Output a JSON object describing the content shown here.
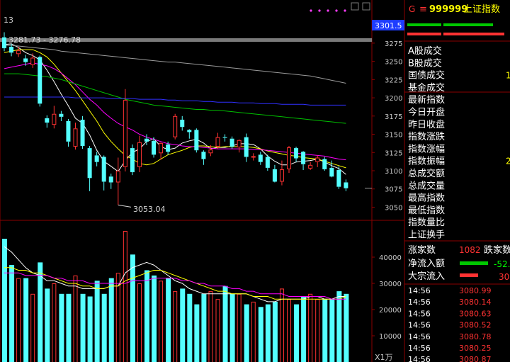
{
  "header": {
    "code": "999999",
    "name": "上证指数",
    "corner_num": "13",
    "current_tag": "3301.5",
    "unit_tag": "X1万",
    "g_label": "G",
    "menu_glyph": "≡"
  },
  "annotations": {
    "range_label": "3281.73 - 3276.78",
    "low_label": "3053.04"
  },
  "side": {
    "stats_labels": [
      "A股成交",
      "B股成交",
      "国债成交",
      "基金成交",
      "最新指数",
      "今日开盘",
      "昨日收盘",
      "指数涨跌",
      "指数涨幅",
      "指数振幅",
      "总成交额",
      "总成交量",
      "最高指数",
      "最低指数",
      "指数量比",
      "上证换手"
    ],
    "stats_partial": [
      {
        "index": 2,
        "text": "1"
      },
      {
        "index": 9,
        "text": "2"
      }
    ],
    "up_down_label": "涨家数",
    "up_count": "1082",
    "down_label": "跌家数",
    "net_inflow_label": "净流入额",
    "net_inflow_value": "-52.",
    "block_label": "大宗流入",
    "block_value": "30.",
    "ticks": [
      {
        "time": "14:56",
        "price": "3080.99"
      },
      {
        "time": "14:56",
        "price": "3080.14"
      },
      {
        "time": "14:56",
        "price": "3080.63"
      },
      {
        "time": "14:56",
        "price": "3080.52"
      },
      {
        "time": "14:56",
        "price": "3080.78"
      },
      {
        "time": "14:56",
        "price": "3080.25"
      },
      {
        "time": "14:56",
        "price": "3080.87"
      }
    ]
  },
  "colors": {
    "up": "#ff3232",
    "down": "#54ffff",
    "grid": "#8b0000",
    "axis_text": "#c8c8c8",
    "ma5": "#ffffff",
    "ma10": "#ffff00",
    "ma20": "#ff00ff",
    "ma30": "#00c000",
    "ma60": "#9a9a9a",
    "ma_blue": "#3030ff",
    "price_tick": "#ff3232",
    "side_label": "#ffffff"
  },
  "chart_data": [
    {
      "type": "candlestick",
      "ylim": [
        3032,
        3305
      ],
      "yticks": [
        3050,
        3075,
        3100,
        3125,
        3150,
        3175,
        3200,
        3225,
        3250,
        3275,
        3300
      ],
      "candles": [
        {
          "o": 3283,
          "c": 3268,
          "h": 3290,
          "l": 3264
        },
        {
          "o": 3270,
          "c": 3262,
          "h": 3274,
          "l": 3257
        },
        {
          "o": 3260,
          "c": 3265,
          "h": 3270,
          "l": 3256
        },
        {
          "o": 3254,
          "c": 3249,
          "h": 3259,
          "l": 3244
        },
        {
          "o": 3245,
          "c": 3255,
          "h": 3261,
          "l": 3241
        },
        {
          "o": 3256,
          "c": 3192,
          "h": 3258,
          "l": 3188
        },
        {
          "o": 3172,
          "c": 3166,
          "h": 3176,
          "l": 3159
        },
        {
          "o": 3163,
          "c": 3178,
          "h": 3189,
          "l": 3158
        },
        {
          "o": 3178,
          "c": 3174,
          "h": 3182,
          "l": 3168
        },
        {
          "o": 3168,
          "c": 3140,
          "h": 3171,
          "l": 3133
        },
        {
          "o": 3133,
          "c": 3158,
          "h": 3166,
          "l": 3129
        },
        {
          "o": 3170,
          "c": 3134,
          "h": 3175,
          "l": 3130
        },
        {
          "o": 3131,
          "c": 3090,
          "h": 3134,
          "l": 3072
        },
        {
          "o": 3121,
          "c": 3112,
          "h": 3126,
          "l": 3106
        },
        {
          "o": 3119,
          "c": 3085,
          "h": 3121,
          "l": 3073
        },
        {
          "o": 3092,
          "c": 3084,
          "h": 3096,
          "l": 3075
        },
        {
          "o": 3084,
          "c": 3100,
          "h": 3118,
          "l": 3053
        },
        {
          "o": 3105,
          "c": 3197,
          "h": 3212,
          "l": 3099
        },
        {
          "o": 3131,
          "c": 3098,
          "h": 3136,
          "l": 3094
        },
        {
          "o": 3105,
          "c": 3139,
          "h": 3148,
          "l": 3098
        },
        {
          "o": 3144,
          "c": 3140,
          "h": 3150,
          "l": 3135
        },
        {
          "o": 3141,
          "c": 3122,
          "h": 3146,
          "l": 3118
        },
        {
          "o": 3124,
          "c": 3138,
          "h": 3139,
          "l": 3115
        },
        {
          "o": 3136,
          "c": 3126,
          "h": 3140,
          "l": 3122
        },
        {
          "o": 3146,
          "c": 3175,
          "h": 3178,
          "l": 3143
        },
        {
          "o": 3170,
          "c": 3160,
          "h": 3175,
          "l": 3155
        },
        {
          "o": 3156,
          "c": 3153,
          "h": 3157,
          "l": 3144
        },
        {
          "o": 3156,
          "c": 3128,
          "h": 3158,
          "l": 3125
        },
        {
          "o": 3126,
          "c": 3116,
          "h": 3128,
          "l": 3108
        },
        {
          "o": 3124,
          "c": 3129,
          "h": 3135,
          "l": 3120
        },
        {
          "o": 3133,
          "c": 3146,
          "h": 3152,
          "l": 3130
        },
        {
          "o": 3146,
          "c": 3145,
          "h": 3150,
          "l": 3140
        },
        {
          "o": 3144,
          "c": 3133,
          "h": 3147,
          "l": 3130
        },
        {
          "o": 3132,
          "c": 3142,
          "h": 3143,
          "l": 3125
        },
        {
          "o": 3146,
          "c": 3119,
          "h": 3151,
          "l": 3112
        },
        {
          "o": 3118,
          "c": 3120,
          "h": 3124,
          "l": 3114
        },
        {
          "o": 3122,
          "c": 3112,
          "h": 3126,
          "l": 3108
        },
        {
          "o": 3119,
          "c": 3104,
          "h": 3122,
          "l": 3100
        },
        {
          "o": 3102,
          "c": 3085,
          "h": 3108,
          "l": 3084
        },
        {
          "o": 3085,
          "c": 3102,
          "h": 3114,
          "l": 3080
        },
        {
          "o": 3102,
          "c": 3132,
          "h": 3134,
          "l": 3097
        },
        {
          "o": 3131,
          "c": 3117,
          "h": 3133,
          "l": 3112
        },
        {
          "o": 3126,
          "c": 3109,
          "h": 3127,
          "l": 3101
        },
        {
          "o": 3103,
          "c": 3108,
          "h": 3112,
          "l": 3101
        },
        {
          "o": 3112,
          "c": 3118,
          "h": 3121,
          "l": 3105
        },
        {
          "o": 3116,
          "c": 3102,
          "h": 3119,
          "l": 3100
        },
        {
          "o": 3104,
          "c": 3092,
          "h": 3114,
          "l": 3091
        },
        {
          "o": 3101,
          "c": 3078,
          "h": 3106,
          "l": 3075
        },
        {
          "o": 3084,
          "c": 3076,
          "h": 3088,
          "l": 3072
        }
      ],
      "moving_averages": [
        {
          "key": "ma5",
          "values": [
            3273,
            3274,
            3269,
            3262,
            3258,
            3252,
            3238,
            3222,
            3205,
            3189,
            3172,
            3165,
            3149,
            3128,
            3113,
            3106,
            3099,
            3114,
            3125,
            3130,
            3140,
            3144,
            3133,
            3129,
            3131,
            3138,
            3141,
            3143,
            3138,
            3130,
            3132,
            3132,
            3134,
            3137,
            3137,
            3136,
            3130,
            3120,
            3113,
            3108,
            3108,
            3112,
            3113,
            3114,
            3116,
            3112,
            3107,
            3103,
            3095
          ]
        },
        {
          "key": "ma10",
          "values": [
            3262,
            3264,
            3266,
            3266,
            3266,
            3262,
            3256,
            3246,
            3234,
            3222,
            3210,
            3196,
            3182,
            3168,
            3152,
            3140,
            3130,
            3121,
            3116,
            3110,
            3108,
            3110,
            3116,
            3122,
            3125,
            3128,
            3132,
            3134,
            3134,
            3133,
            3132,
            3133,
            3133,
            3133,
            3133,
            3132,
            3130,
            3127,
            3125,
            3123,
            3121,
            3120,
            3118,
            3117,
            3116,
            3113,
            3110,
            3107,
            3104
          ]
        },
        {
          "key": "ma20",
          "values": [
            3240,
            3242,
            3244,
            3246,
            3248,
            3246,
            3244,
            3240,
            3234,
            3226,
            3218,
            3208,
            3198,
            3190,
            3180,
            3172,
            3165,
            3160,
            3156,
            3150,
            3146,
            3143,
            3140,
            3137,
            3136,
            3134,
            3133,
            3133,
            3132,
            3131,
            3130,
            3130,
            3130,
            3130,
            3130,
            3129,
            3129,
            3128,
            3127,
            3126,
            3125,
            3124,
            3123,
            3122,
            3121,
            3120,
            3118,
            3116,
            3115
          ]
        },
        {
          "key": "ma30",
          "values": [
            3233,
            3233,
            3233,
            3232,
            3231,
            3230,
            3229,
            3227,
            3225,
            3222,
            3219,
            3216,
            3213,
            3210,
            3207,
            3204,
            3201,
            3198,
            3196,
            3194,
            3192,
            3190,
            3189,
            3188,
            3187,
            3186,
            3185,
            3184,
            3184,
            3183,
            3183,
            3182,
            3181,
            3180,
            3179,
            3178,
            3177,
            3176,
            3175,
            3174,
            3173,
            3172,
            3171,
            3170,
            3169,
            3168,
            3167,
            3166,
            3165
          ]
        },
        {
          "key": "ma60",
          "values": [
            3272,
            3272,
            3271,
            3270,
            3269,
            3268,
            3267,
            3266,
            3264,
            3263,
            3262,
            3261,
            3260,
            3259,
            3258,
            3257,
            3256,
            3255,
            3254,
            3253,
            3252,
            3251,
            3250,
            3249,
            3249,
            3248,
            3247,
            3246,
            3245,
            3244,
            3243,
            3242,
            3241,
            3240,
            3239,
            3238,
            3237,
            3236,
            3235,
            3234,
            3233,
            3232,
            3231,
            3230,
            3228,
            3226,
            3224,
            3222,
            3220
          ]
        },
        {
          "key": "ma_blue",
          "values": [
            3201,
            3201,
            3201,
            3201,
            3201,
            3201,
            3201,
            3201,
            3201,
            3201,
            3200,
            3200,
            3200,
            3200,
            3200,
            3199,
            3199,
            3199,
            3199,
            3198,
            3198,
            3198,
            3198,
            3197,
            3197,
            3196,
            3196,
            3196,
            3195,
            3195,
            3194,
            3194,
            3194,
            3193,
            3193,
            3193,
            3192,
            3192,
            3192,
            3191,
            3191,
            3191,
            3191,
            3190,
            3190,
            3190,
            3190,
            3190,
            3190
          ]
        }
      ],
      "range_band": [
        3276.78,
        3281.73
      ]
    },
    {
      "type": "bar",
      "ylim": [
        0,
        50000
      ],
      "yticks": [
        10000,
        20000,
        30000,
        40000
      ],
      "volumes": [
        47000,
        37000,
        32000,
        32000,
        26000,
        38000,
        28000,
        30000,
        26000,
        26000,
        33000,
        26000,
        25000,
        31000,
        26000,
        32000,
        34000,
        50000,
        41000,
        30000,
        35000,
        33000,
        31000,
        32000,
        27000,
        28000,
        26000,
        22000,
        26000,
        27000,
        24000,
        29000,
        26000,
        26000,
        22000,
        23000,
        21000,
        22000,
        23000,
        28000,
        24000,
        22000,
        25000,
        26000,
        24000,
        24000,
        24000,
        27000,
        26000
      ],
      "vol_ma": [
        {
          "key": "ma5",
          "values": [
            44000,
            42000,
            39000,
            36000,
            34000,
            33000,
            31000,
            31000,
            30000,
            29000,
            29000,
            28000,
            28000,
            28000,
            28000,
            29000,
            29000,
            34000,
            36000,
            37000,
            38000,
            37000,
            35000,
            33000,
            31000,
            30000,
            28000,
            27000,
            26000,
            26000,
            26000,
            26000,
            26000,
            26000,
            26000,
            25000,
            24000,
            23000,
            23000,
            24000,
            24000,
            24000,
            24000,
            25000,
            25000,
            24000,
            24000,
            25000,
            25000
          ]
        },
        {
          "key": "ma10",
          "values": [
            36000,
            36000,
            35000,
            35000,
            34000,
            34000,
            33000,
            32000,
            31000,
            30000,
            30000,
            29000,
            29000,
            28000,
            28000,
            29000,
            29000,
            31000,
            32000,
            33000,
            34000,
            35000,
            35000,
            34000,
            33000,
            32000,
            31000,
            30000,
            29000,
            28000,
            27000,
            27000,
            26000,
            26000,
            26000,
            25000,
            25000,
            25000,
            24000,
            24000,
            24000,
            24000,
            24000,
            24000,
            24000,
            24000,
            24000,
            24000,
            25000
          ]
        },
        {
          "key": "ma20",
          "values": [
            34000,
            34000,
            34000,
            33000,
            33000,
            33000,
            33000,
            32000,
            32000,
            31000,
            31000,
            31000,
            30000,
            30000,
            30000,
            30000,
            30000,
            30000,
            31000,
            31000,
            31000,
            32000,
            32000,
            32000,
            32000,
            31000,
            31000,
            30000,
            30000,
            29000,
            29000,
            29000,
            28000,
            28000,
            27000,
            27000,
            26000,
            26000,
            26000,
            26000,
            25000,
            25000,
            25000,
            25000,
            25000,
            25000,
            24000,
            24000,
            24000
          ]
        }
      ]
    }
  ]
}
